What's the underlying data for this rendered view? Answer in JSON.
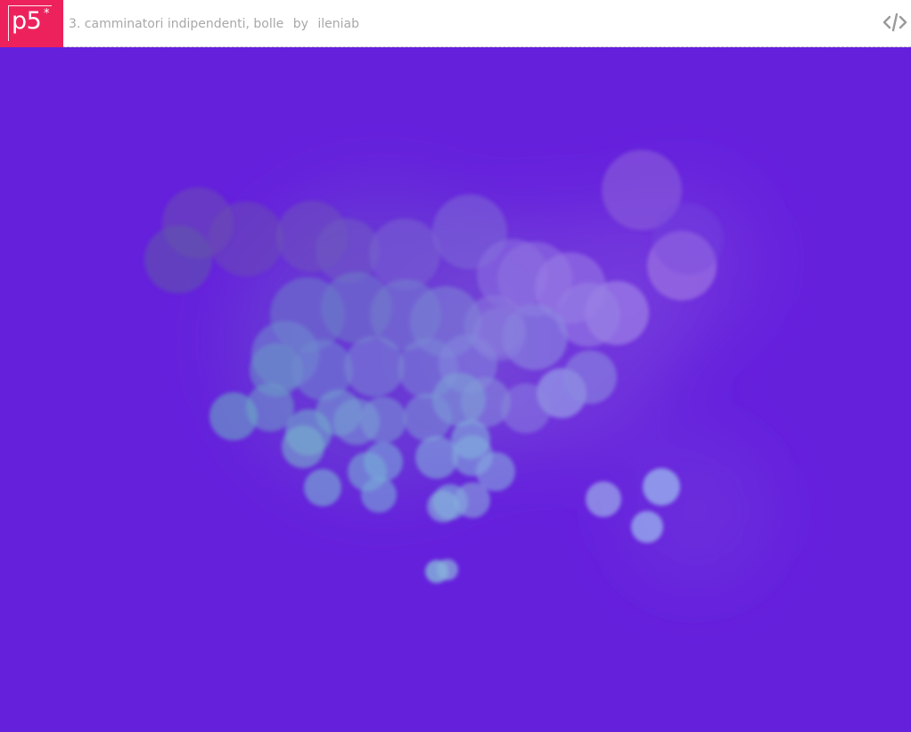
{
  "header": {
    "logo_text": "p5",
    "logo_star": "*",
    "sketch_title": "3. camminatori indipendenti, bolle",
    "by_label": "by",
    "author": "ileniab",
    "code_icon": "code-icon"
  },
  "canvas": {
    "background_color": "#6520dc",
    "bubble_colors": [
      "#7f5bd6",
      "#6f86c9",
      "#7fa7d8",
      "#9a7de0"
    ]
  }
}
